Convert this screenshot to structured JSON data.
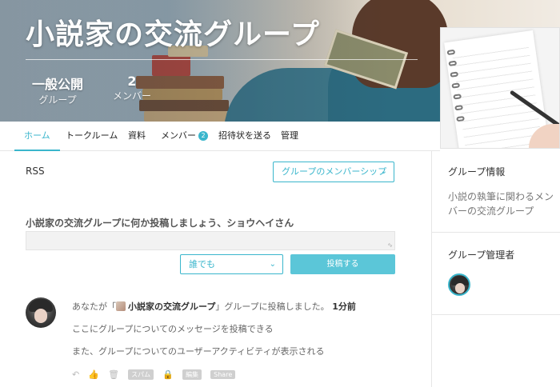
{
  "banner": {
    "title": "小説家の交流グループ",
    "privacy": "一般公開",
    "privacy_caption": "グループ",
    "member_count": "2",
    "member_caption": "メンバー"
  },
  "nav": {
    "items": [
      {
        "label": "ホーム",
        "active": true
      },
      {
        "label": "トークルーム"
      },
      {
        "label": "資料"
      },
      {
        "label": "メンバー",
        "badge": "2"
      },
      {
        "label": "招待状を送る"
      },
      {
        "label": "管理"
      }
    ]
  },
  "main": {
    "rss": "RSS",
    "membership_button": "グループのメンバーシップ",
    "post_prompt": "小説家の交流グループに何か投稿しましょう、ショウヘイさん",
    "audience_select": "誰でも",
    "post_button": "投稿する"
  },
  "activity": {
    "line_prefix": "あなたが「",
    "group_name": "小説家の交流グループ",
    "line_suffix": "」グループに投稿しました。",
    "time": "1分前",
    "message_1": "ここにグループについてのメッセージを投稿できる",
    "message_2": "また、グループについてのユーザーアクティビティが表示される",
    "tag_spam": "スパム",
    "tag_edit": "編集",
    "tag_share": "Share"
  },
  "sidebar": {
    "info_title": "グループ情報",
    "info_desc": "小説の執筆に関わるメンバーの交流グループ",
    "admin_title": "グループ管理者"
  },
  "colors": {
    "accent": "#3ab6cc",
    "post_button": "#5bc6d8"
  }
}
